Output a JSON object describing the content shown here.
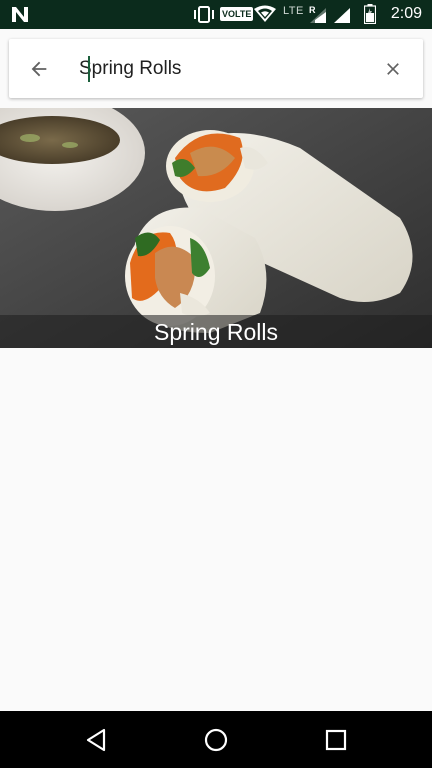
{
  "status_bar": {
    "volte_label": "VOLTE",
    "network_label": "LTE",
    "roaming_label": "R",
    "time": "2:09",
    "icons": [
      "n-logo-icon",
      "vibrate-icon",
      "wifi-icon",
      "signal-icon",
      "battery-icon"
    ]
  },
  "search": {
    "query": "Spring Rolls",
    "back_icon": "arrow-back-icon",
    "clear_icon": "close-icon"
  },
  "results": [
    {
      "title": "Spring Rolls"
    }
  ],
  "nav_bar": {
    "icons": [
      "nav-back-icon",
      "nav-home-icon",
      "nav-recents-icon"
    ]
  },
  "colors": {
    "status_bar_bg": "#0b2b1c",
    "cursor": "#1b5e3b",
    "page_bg": "#fafafa"
  }
}
